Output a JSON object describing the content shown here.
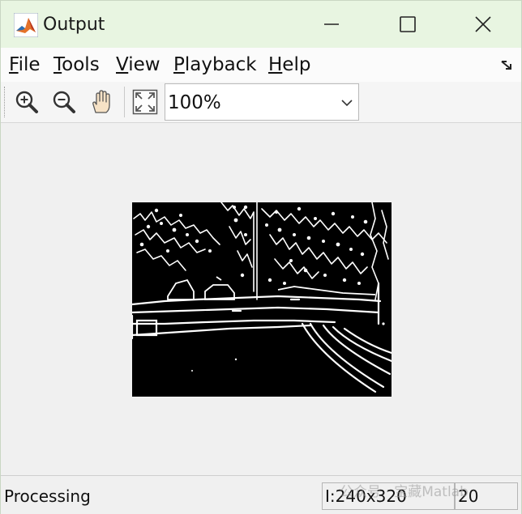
{
  "window": {
    "title": "Output"
  },
  "menu": {
    "items": [
      {
        "mnemonic": "F",
        "rest": "ile"
      },
      {
        "mnemonic": "T",
        "rest": "ools"
      },
      {
        "mnemonic": "V",
        "rest": "iew"
      },
      {
        "mnemonic": "P",
        "rest": "layback"
      },
      {
        "mnemonic": "H",
        "rest": "elp"
      }
    ]
  },
  "toolbar": {
    "zoom_value": "100%"
  },
  "status": {
    "text": "Processing",
    "frame_info": "I:240x320",
    "frame_number": "20"
  },
  "watermark": {
    "text": "公众号 · 宝藏Matlab"
  },
  "icons": {
    "app": "matlab-logo-icon",
    "minimize": "minimize-icon",
    "maximize": "maximize-icon",
    "close": "close-icon",
    "zoom_in": "zoom-in-icon",
    "zoom_out": "zoom-out-icon",
    "pan": "pan-hand-icon",
    "fit": "fit-to-window-icon",
    "dropdown": "chevron-down-icon",
    "dock": "dock-arrow-icon"
  }
}
